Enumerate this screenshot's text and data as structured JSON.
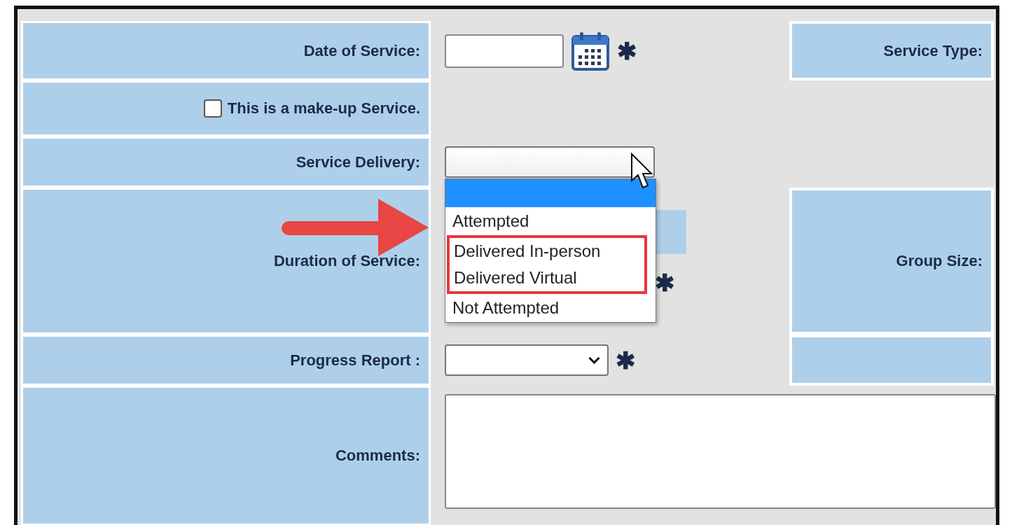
{
  "form": {
    "rows": [
      {
        "kind": "date",
        "label": "Date of Service:",
        "required": "✱",
        "side_cell": true,
        "side_label": "Service Type:"
      },
      {
        "kind": "checkbox",
        "label": "This is a make-up Service.",
        "checked": false
      },
      {
        "kind": "select",
        "label": "Service Delivery:",
        "expanded": true,
        "options": [
          {
            "selected": true,
            "highlighted": false
          },
          {
            "label": "Attempted",
            "selected": false,
            "highlighted": false
          },
          {
            "label": "Delivered In-person",
            "selected": false,
            "highlighted": true
          },
          {
            "label": "Delivered Virtual",
            "selected": false,
            "highlighted": true
          },
          {
            "label": "Not Attempted",
            "selected": false,
            "highlighted": false
          }
        ]
      },
      {
        "kind": "duration",
        "label": "Duration of Service:",
        "required": "✱",
        "side_cell": true,
        "side_label": "Group Size:"
      },
      {
        "kind": "select",
        "label": "Progress Report :",
        "expanded": false,
        "required": "✱",
        "side_cell": true
      },
      {
        "kind": "textarea",
        "label": "Comments:"
      }
    ]
  },
  "annotation": {
    "arrow": true,
    "cursor": true
  }
}
